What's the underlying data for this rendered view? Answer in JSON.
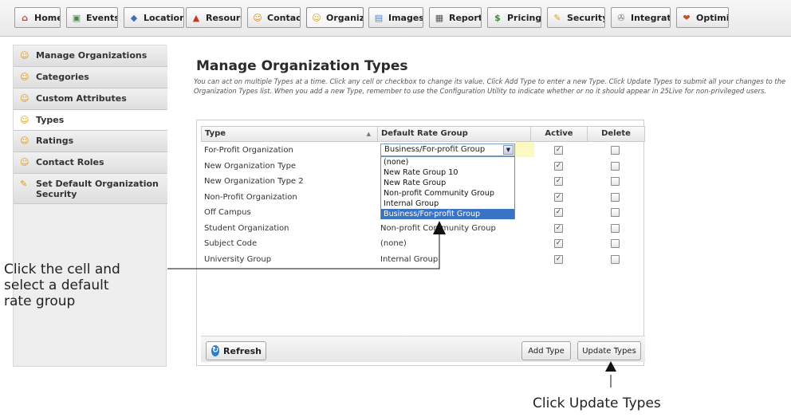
{
  "tabs": [
    {
      "label": "Home",
      "icon": "home-icon",
      "glyph": "⌂",
      "color": "#b84a3a",
      "active": false
    },
    {
      "label": "Events",
      "icon": "events-icon",
      "glyph": "▣",
      "color": "#4a8a4a",
      "active": false
    },
    {
      "label": "Locations",
      "icon": "locations-icon",
      "glyph": "◆",
      "color": "#4a6ab8",
      "active": false
    },
    {
      "label": "Resource",
      "icon": "resource-icon",
      "glyph": "▲",
      "color": "#c0392b",
      "active": false
    },
    {
      "label": "Contacts",
      "icon": "contacts-icon",
      "glyph": "☺",
      "color": "#d98a1a",
      "active": false
    },
    {
      "label": "Organizat",
      "icon": "organizations-icon",
      "glyph": "☺",
      "color": "#d9a21a",
      "active": true
    },
    {
      "label": "Images",
      "icon": "images-icon",
      "glyph": "▤",
      "color": "#4a8ac8",
      "active": false
    },
    {
      "label": "Reports",
      "icon": "reports-icon",
      "glyph": "▦",
      "color": "#555555",
      "active": false
    },
    {
      "label": "Pricing",
      "icon": "pricing-icon",
      "glyph": "$",
      "color": "#3a8a3a",
      "active": false
    },
    {
      "label": "Security",
      "icon": "security-icon",
      "glyph": "✎",
      "color": "#d9a21a",
      "active": false
    },
    {
      "label": "Integratic",
      "icon": "integration-icon",
      "glyph": "✇",
      "color": "#7a7a7a",
      "active": false
    },
    {
      "label": "Optimizer",
      "icon": "optimizer-icon",
      "glyph": "❤",
      "color": "#c84a2a",
      "active": false
    }
  ],
  "sidebar": {
    "items": [
      {
        "label": "Manage Organizations",
        "selected": false
      },
      {
        "label": "Categories",
        "selected": false
      },
      {
        "label": "Custom Attributes",
        "selected": false
      },
      {
        "label": "Types",
        "selected": true
      },
      {
        "label": "Ratings",
        "selected": false
      },
      {
        "label": "Contact Roles",
        "selected": false
      },
      {
        "label": "Set Default Organization Security",
        "selected": false
      }
    ]
  },
  "main": {
    "title": "Manage Organization Types",
    "description": "You can act on multiple Types at a time. Click any cell or checkbox to change its value. Click Add Type to enter a new Type. Click Update Types to submit all your changes to the Organization Types list. When you add a new Type, remember to use the Configuration Utility to indicate whether or no it should appear in 25Live for non-privileged users."
  },
  "grid": {
    "columns": {
      "type": "Type",
      "rate": "Default Rate Group",
      "active": "Active",
      "delete": "Delete"
    },
    "rows": [
      {
        "type": "For-Profit Organization",
        "rate": "Business/For-profit Group",
        "active": true,
        "delete": false
      },
      {
        "type": "New Organization Type",
        "rate": "",
        "active": true,
        "delete": false
      },
      {
        "type": "New Organization Type 2",
        "rate": "",
        "active": true,
        "delete": false
      },
      {
        "type": "Non-Profit Organization",
        "rate": "",
        "active": true,
        "delete": false
      },
      {
        "type": "Off Campus",
        "rate": "",
        "active": true,
        "delete": false
      },
      {
        "type": "Student Organization",
        "rate": "Non-profit Community Group",
        "active": true,
        "delete": false
      },
      {
        "type": "Subject Code",
        "rate": "(none)",
        "active": true,
        "delete": false
      },
      {
        "type": "University Group",
        "rate": "Internal Group",
        "active": true,
        "delete": false
      }
    ],
    "dropdown": {
      "value": "Business/For-profit Group",
      "options": [
        "(none)",
        "New Rate Group 10",
        "New Rate Group",
        "Non-profit Community Group",
        "Internal Group",
        "Business/For-profit Group"
      ],
      "selected_index": 5
    },
    "buttons": {
      "refresh": "Refresh",
      "add": "Add Type",
      "update": "Update Types"
    }
  },
  "annotations": {
    "callout_left": [
      "Click the cell and",
      "select a default",
      "rate group"
    ],
    "callout_bottom": "Click Update Types"
  }
}
